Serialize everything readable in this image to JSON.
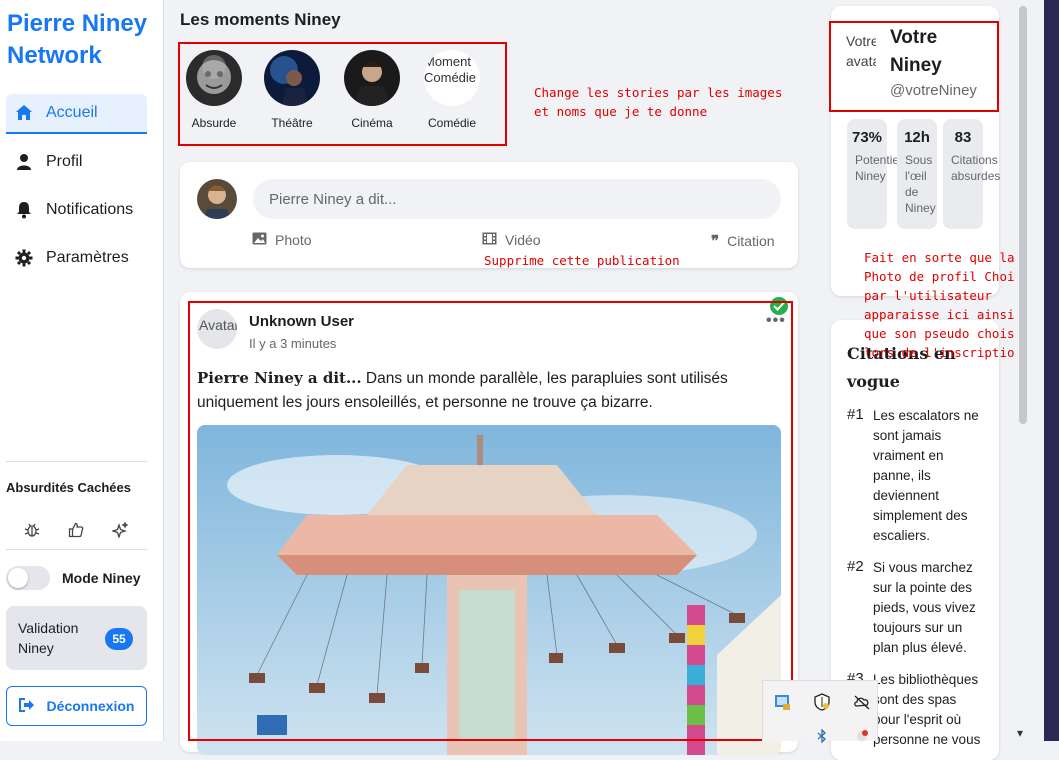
{
  "brand": "Pierre Niney Network",
  "nav": [
    {
      "label": "Accueil",
      "icon": "home-icon"
    },
    {
      "label": "Profil",
      "icon": "user-icon"
    },
    {
      "label": "Notifications",
      "icon": "bell-icon"
    },
    {
      "label": "Paramètres",
      "icon": "gear-icon"
    }
  ],
  "sidebar_bottom": {
    "hidden_title": "Absurdités Cachées",
    "mode_label": "Mode Niney",
    "validation_label": "Validation Niney",
    "validation_count": "55",
    "logout_label": "Déconnexion"
  },
  "stories": {
    "title": "Les moments Niney",
    "items": [
      {
        "label": "Absurde"
      },
      {
        "label": "Théâtre"
      },
      {
        "label": "Cinéma"
      },
      {
        "label": "Comédie",
        "broken_alt": "Moment Comédie"
      }
    ]
  },
  "annotations": {
    "stories_note": "Change les stories par les images et noms que je te donne",
    "delete_note": "Supprime cette publication",
    "profile_note": "Fait en sorte que la Photo de profil Choisi par l'utilisateur apparaisse ici ainsi que son pseudo choisi lors de l'inscription"
  },
  "composer": {
    "placeholder": "Pierre Niney a dit...",
    "actions": [
      {
        "label": "Photo",
        "icon": "image-icon"
      },
      {
        "label": "Vidéo",
        "icon": "video-icon"
      },
      {
        "label": "Citation",
        "icon": "quote-icon"
      }
    ]
  },
  "post": {
    "author": "Unknown User",
    "avatar_alt": "Avatar",
    "time": "Il y a 3 minutes",
    "lead": "Pierre Niney a dit...",
    "text": " Dans un monde parallèle, les parapluies sont utilisés uniquement les jours ensoleillés, et personne ne trouve ça bizarre.",
    "menu": "•••"
  },
  "profile": {
    "img_alt": "Votre avatar",
    "name": "Votre Niney",
    "handle": "@votreNiney",
    "stats": [
      {
        "value": "73%",
        "label": "Potentiel Niney"
      },
      {
        "value": "12h",
        "label": "Sous l'œil de Niney"
      },
      {
        "value": "83",
        "label": "Citations absurdes"
      }
    ]
  },
  "quotes": {
    "title": "Citations en vogue",
    "items": [
      {
        "n": "#1",
        "text": "Les escalators ne sont jamais vraiment en panne, ils deviennent simplement des escaliers."
      },
      {
        "n": "#2",
        "text": "Si vous marchez sur la pointe des pieds, vous vivez toujours sur un plan plus élevé."
      },
      {
        "n": "#3",
        "text": "Les bibliothèques sont des spas pour l'esprit où personne ne vous"
      }
    ]
  },
  "colors": {
    "accent": "#1877f2",
    "annotation": "#e00000"
  }
}
